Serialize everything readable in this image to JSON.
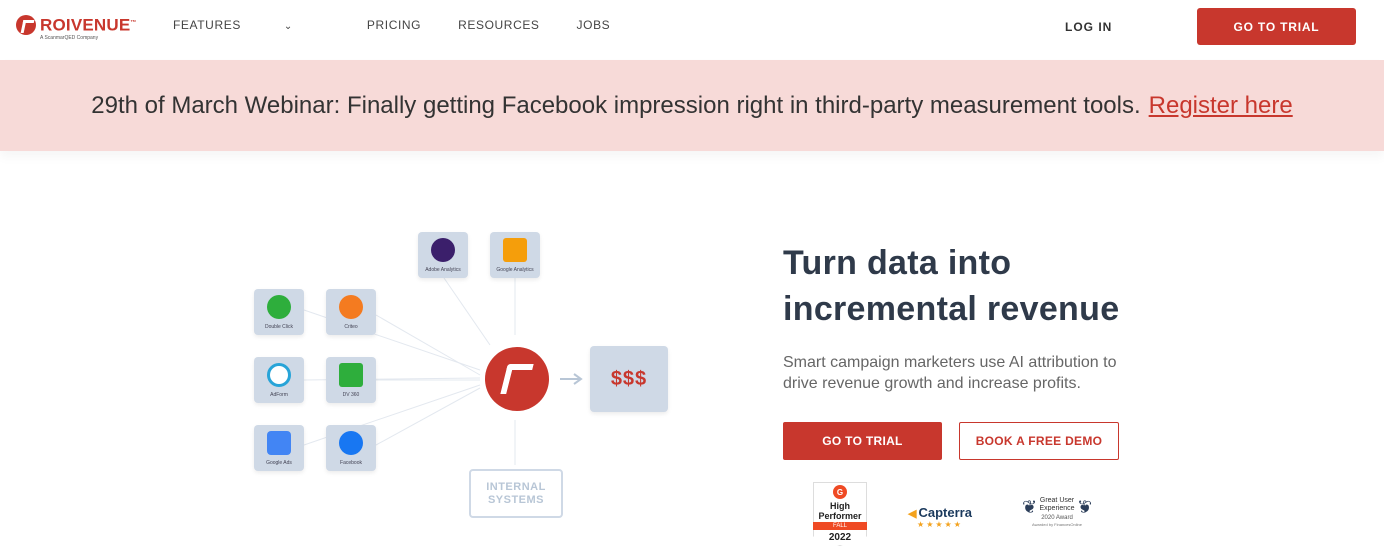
{
  "nav": {
    "logo_name": "ROIVENUE",
    "logo_tm": "™",
    "logo_sub": "A ScanmarQED Company",
    "links": [
      "FEATURES",
      "PRICING",
      "RESOURCES",
      "JOBS"
    ],
    "login": "LOG IN",
    "trial": "GO TO TRIAL"
  },
  "banner": {
    "text": "29th of March Webinar: Finally getting Facebook impression right in third-party measurement tools.",
    "link": "Register here"
  },
  "diagram": {
    "tiles": [
      {
        "label": "Adobe Analytics",
        "icon": "adobe-analytics-icon",
        "color": "#3b1f6b"
      },
      {
        "label": "Google Analytics",
        "icon": "google-analytics-icon",
        "color": "#f59e0b"
      },
      {
        "label": "Double Click",
        "icon": "doubleclick-icon",
        "color": "#2eae3c"
      },
      {
        "label": "Criteo",
        "icon": "criteo-icon",
        "color": "#f47b20"
      },
      {
        "label": "AdForm",
        "icon": "adform-icon",
        "color": "#28a4d8"
      },
      {
        "label": "DV 360",
        "icon": "dv360-icon",
        "color": "#2eae3c"
      },
      {
        "label": "Google Ads",
        "icon": "google-ads-icon",
        "color": "#4285f4"
      },
      {
        "label": "Facebook",
        "icon": "facebook-icon",
        "color": "#1877f2"
      }
    ],
    "result": "$$$",
    "internal_line1": "INTERNAL",
    "internal_line2": "SYSTEMS"
  },
  "hero": {
    "title_line1": "Turn data into",
    "title_line2": "incremental revenue",
    "description": "Smart campaign marketers use AI attribution to drive revenue growth and increase profits.",
    "cta_primary": "GO TO TRIAL",
    "cta_secondary": "BOOK A FREE DEMO"
  },
  "badges": {
    "g2_line1": "High",
    "g2_line2": "Performer",
    "g2_season": "FALL",
    "g2_year": "2022",
    "capterra_name": "Capterra",
    "capterra_stars": "★★★★★",
    "ff_line1": "Great User",
    "ff_line2": "Experience",
    "ff_line3": "2020 Award",
    "ff_line4": "Awarded by FinancesOnline"
  },
  "colors": {
    "brand": "#c8372d",
    "banner_bg": "#f7dad8",
    "tile_bg": "#cfd9e6"
  }
}
